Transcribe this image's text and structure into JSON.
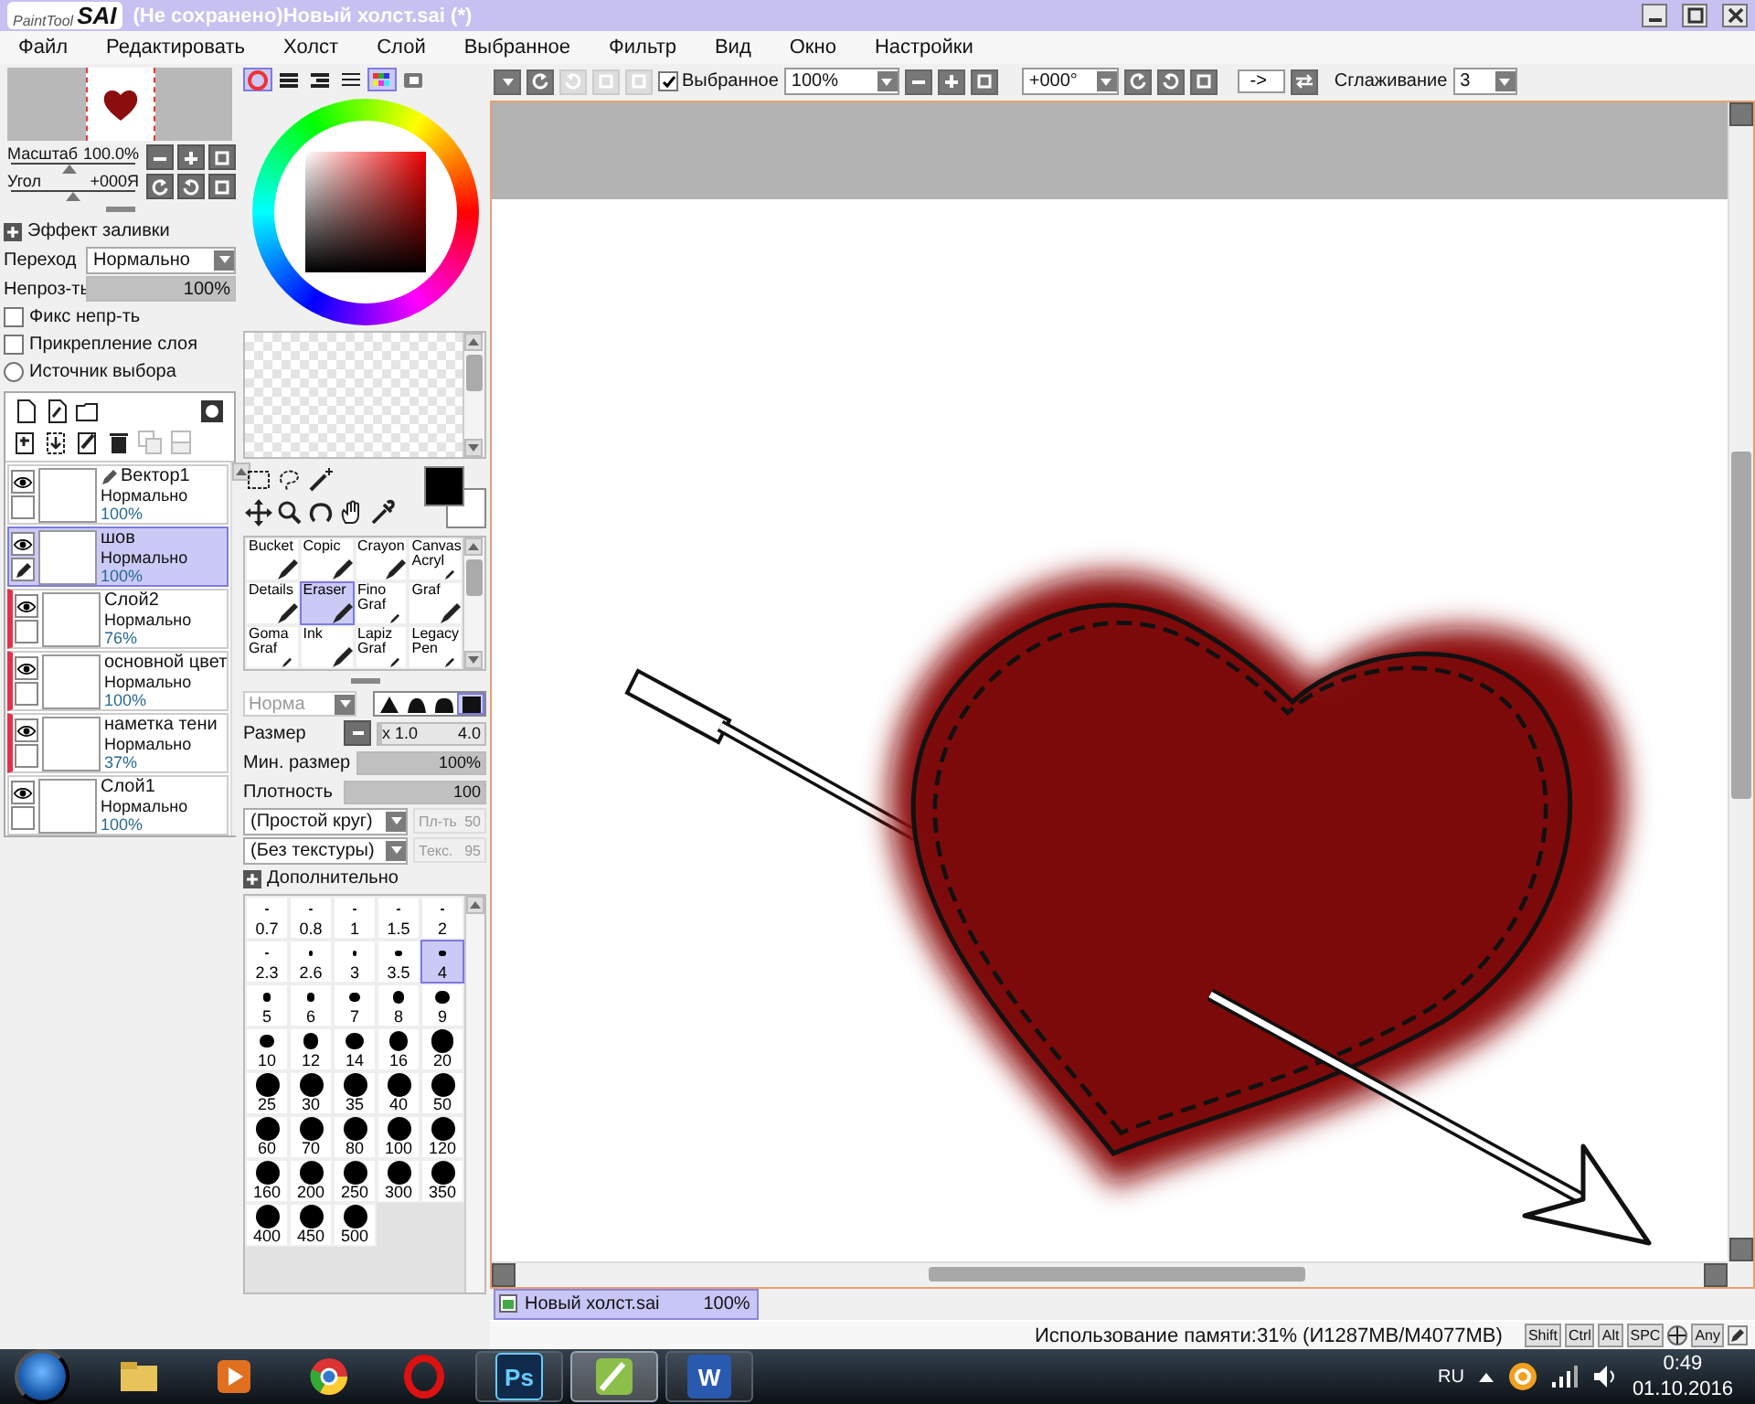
{
  "window": {
    "logo_small": "PaintTool",
    "logo_big": "SAI",
    "title": "(Не сохранено)Новый холст.sai (*)"
  },
  "menu": [
    "Файл",
    "Редактировать",
    "Холст",
    "Слой",
    "Выбранное",
    "Фильтр",
    "Вид",
    "Окно",
    "Настройки"
  ],
  "navigator": {
    "sliders": [
      {
        "label": "Масштаб",
        "value": "100.0%",
        "level": 0.47
      },
      {
        "label": "Угол",
        "value": "+000Я",
        "level": 0.5
      }
    ]
  },
  "layer_properties": {
    "fill_effect": "Эффект заливки",
    "blend_label": "Переход",
    "blend_value": "Нормально",
    "opacity": {
      "label": "Непроз-ть",
      "value": "100%",
      "level": 1
    },
    "options": [
      {
        "kind": "checkbox",
        "label": "Фикс непр-ть",
        "checked": false
      },
      {
        "kind": "checkbox",
        "label": "Прикрепление слоя",
        "checked": false
      },
      {
        "kind": "radio",
        "label": "Источник выбора",
        "checked": false
      }
    ]
  },
  "layers": [
    {
      "kind": "vector",
      "name": "Вектор1",
      "mode": "Нормально",
      "opacity": "100%",
      "visible": true,
      "selected": false,
      "clipped": false
    },
    {
      "kind": "raster",
      "name": "шов",
      "mode": "Нормально",
      "opacity": "100%",
      "visible": true,
      "selected": true,
      "clipped": false
    },
    {
      "kind": "raster",
      "name": "Слой2",
      "mode": "Нормально",
      "opacity": "76%",
      "visible": true,
      "selected": false,
      "clipped": true
    },
    {
      "kind": "raster",
      "name": "основной цвет",
      "mode": "Нормально",
      "opacity": "100%",
      "visible": true,
      "selected": false,
      "clipped": true
    },
    {
      "kind": "raster",
      "name": "наметка тени",
      "mode": "Нормально",
      "opacity": "37%",
      "visible": true,
      "selected": false,
      "clipped": true
    },
    {
      "kind": "raster",
      "name": "Слой1",
      "mode": "Нормально",
      "opacity": "100%",
      "visible": true,
      "selected": false,
      "clipped": false
    }
  ],
  "color_panels": [
    {
      "selected": true
    },
    {
      "selected": false
    },
    {
      "selected": false
    },
    {
      "selected": false
    },
    {
      "selected": true
    },
    {
      "selected": false
    }
  ],
  "brushes": [
    {
      "label": "Bucket",
      "selected": false
    },
    {
      "label": "Copic",
      "selected": false
    },
    {
      "label": "Crayon",
      "selected": false
    },
    {
      "label": "Canvas Acryl",
      "selected": false
    },
    {
      "label": "Details",
      "selected": false
    },
    {
      "label": "Eraser",
      "selected": true
    },
    {
      "label": "Fino Graf",
      "selected": false
    },
    {
      "label": "Graf",
      "selected": false
    },
    {
      "label": "Goma Graf",
      "selected": false
    },
    {
      "label": "Ink",
      "selected": false
    },
    {
      "label": "Lapiz Graf",
      "selected": false
    },
    {
      "label": "Legacy Pen",
      "selected": false
    }
  ],
  "brush_settings": {
    "mode": {
      "value": "Норма",
      "disabled": true
    },
    "shapes": [
      {
        "selected": false
      },
      {
        "selected": false
      },
      {
        "selected": false
      },
      {
        "selected": true
      }
    ],
    "size": {
      "label": "Размер",
      "multiplier": "x 1.0",
      "value": "4.0",
      "level": 0.03
    },
    "min_size": {
      "label": "Мин. размер",
      "value": "100%",
      "level": 1
    },
    "density": {
      "label": "Плотность",
      "value": "100",
      "level": 1
    },
    "shape_dropdown": "(Простой круг)",
    "blend_field": {
      "label": "Пл-ть",
      "value": "50",
      "disabled": true
    },
    "texture_dropdown": "(Без текстуры)",
    "texture_field": {
      "label": "Текс.",
      "value": "95",
      "disabled": true
    },
    "advanced": "Дополнительно"
  },
  "sizes": [
    {
      "label": "0.7",
      "selected": false
    },
    {
      "label": "0.8",
      "selected": false
    },
    {
      "label": "1",
      "selected": false
    },
    {
      "label": "1.5",
      "selected": false
    },
    {
      "label": "2",
      "selected": false
    },
    {
      "label": "2.3",
      "selected": false
    },
    {
      "label": "2.6",
      "selected": false
    },
    {
      "label": "3",
      "selected": false
    },
    {
      "label": "3.5",
      "selected": false
    },
    {
      "label": "4",
      "selected": true
    },
    {
      "label": "5",
      "selected": false
    },
    {
      "label": "6",
      "selected": false
    },
    {
      "label": "7",
      "selected": false
    },
    {
      "label": "8",
      "selected": false
    },
    {
      "label": "9",
      "selected": false
    },
    {
      "label": "10",
      "selected": false
    },
    {
      "label": "12",
      "selected": false
    },
    {
      "label": "14",
      "selected": false
    },
    {
      "label": "16",
      "selected": false
    },
    {
      "label": "20",
      "selected": false
    },
    {
      "label": "25",
      "selected": false
    },
    {
      "label": "30",
      "selected": false
    },
    {
      "label": "35",
      "selected": false
    },
    {
      "label": "40",
      "selected": false
    },
    {
      "label": "50",
      "selected": false
    },
    {
      "label": "60",
      "selected": false
    },
    {
      "label": "70",
      "selected": false
    },
    {
      "label": "80",
      "selected": false
    },
    {
      "label": "100",
      "selected": false
    },
    {
      "label": "120",
      "selected": false
    },
    {
      "label": "160",
      "selected": false
    },
    {
      "label": "200",
      "selected": false
    },
    {
      "label": "250",
      "selected": false
    },
    {
      "label": "300",
      "selected": false
    },
    {
      "label": "350",
      "selected": false
    },
    {
      "label": "400",
      "selected": false
    },
    {
      "label": "450",
      "selected": false
    },
    {
      "label": "500",
      "selected": false
    }
  ],
  "canvas_toolbar": {
    "selection": {
      "label": "Выбранное",
      "checked": true
    },
    "zoom": "100%",
    "angle": "+000°",
    "flip": "->",
    "smoothing_label": "Сглаживание",
    "smoothing": "3"
  },
  "documents": [
    {
      "name": "Новый холст.sai",
      "zoom": "100%",
      "selected": true
    }
  ],
  "status": {
    "memory": "Использование памяти:31% (И1287MB/M4077MB)",
    "keys": [
      "Shift",
      "Ctrl",
      "Alt",
      "SPC",
      "Any"
    ]
  },
  "taskbar": {
    "apps": [
      {
        "kind": "explorer",
        "running": false,
        "selected": false
      },
      {
        "kind": "media",
        "running": false,
        "selected": false
      },
      {
        "kind": "chrome",
        "running": false,
        "selected": false
      },
      {
        "kind": "opera",
        "running": false,
        "selected": false
      },
      {
        "kind": "photoshop",
        "label": "Ps",
        "running": true,
        "selected": false
      },
      {
        "kind": "sai",
        "running": true,
        "selected": true
      },
      {
        "kind": "word",
        "label": "W",
        "running": true,
        "selected": false
      }
    ],
    "language": "RU",
    "time": "0:49",
    "date": "01.10.2016"
  }
}
